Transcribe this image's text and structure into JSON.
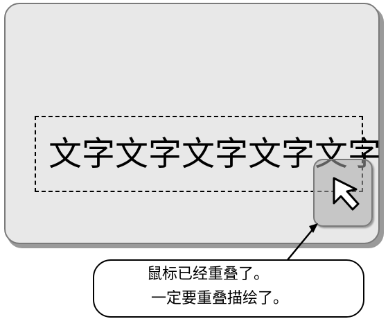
{
  "screen": {
    "big_text": "文字文字文字文字文字"
  },
  "cursor": {
    "icon": "arrow-cursor-icon"
  },
  "callout": {
    "line1": "鼠标已经重叠了。",
    "line2": "一定要重叠描绘了。"
  }
}
